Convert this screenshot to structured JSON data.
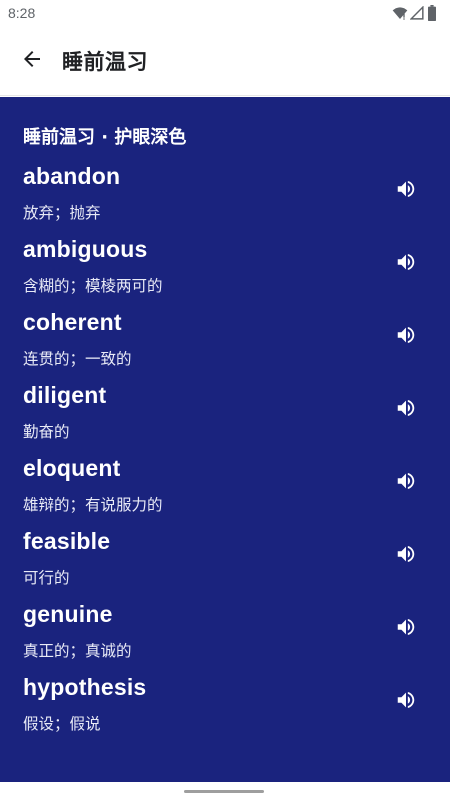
{
  "status_bar": {
    "time": "8:28",
    "icons": [
      "wifi-icon",
      "signal-icon",
      "battery-icon"
    ]
  },
  "app_bar": {
    "title": "睡前温习",
    "back_icon": "arrow-back-icon"
  },
  "content": {
    "background_color": "#1a237e",
    "section_title": "睡前温习 · 护眼深色",
    "words": [
      {
        "word": "abandon",
        "meaning": "放弃；抛弃"
      },
      {
        "word": "ambiguous",
        "meaning": "含糊的；模棱两可的"
      },
      {
        "word": "coherent",
        "meaning": "连贯的；一致的"
      },
      {
        "word": "diligent",
        "meaning": "勤奋的"
      },
      {
        "word": "eloquent",
        "meaning": "雄辩的；有说服力的"
      },
      {
        "word": "feasible",
        "meaning": "可行的"
      },
      {
        "word": "genuine",
        "meaning": "真正的；真诚的"
      },
      {
        "word": "hypothesis",
        "meaning": "假设；假说"
      }
    ],
    "speak_icon": "volume-up-icon"
  }
}
